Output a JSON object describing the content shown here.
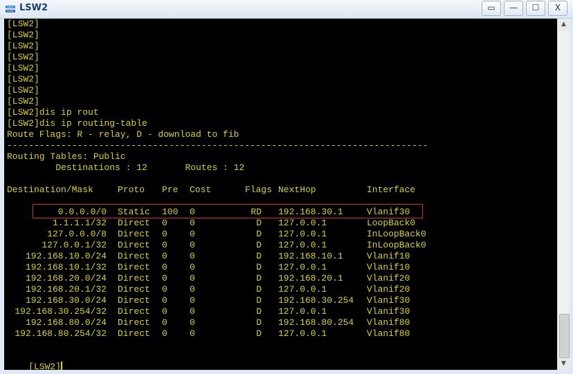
{
  "window": {
    "title": "LSW2",
    "icon": "switch-icon",
    "buttons": [
      {
        "name": "restore-frame-button",
        "glyph": "▭"
      },
      {
        "name": "minimize-button",
        "glyph": "—"
      },
      {
        "name": "maximize-button",
        "glyph": "☐"
      },
      {
        "name": "close-button",
        "glyph": "X"
      }
    ]
  },
  "terminal": {
    "lines": [
      "[LSW2]",
      "[LSW2]",
      "[LSW2]",
      "[LSW2]",
      "[LSW2]",
      "[LSW2]",
      "[LSW2]",
      "[LSW2]",
      "[LSW2]dis ip rout",
      "[LSW2]dis ip routing-table",
      "Route Flags: R - relay, D - download to fib",
      "------------------------------------------------------------------------------",
      "Routing Tables: Public",
      "         Destinations : 12       Routes : 12"
    ],
    "table": {
      "headers": {
        "destination": "Destination/Mask",
        "proto": "Proto",
        "pre": "Pre",
        "cost": "Cost",
        "flags": "Flags",
        "nexthop": "NextHop",
        "interface": "Interface"
      },
      "rows": [
        {
          "destination": "0.0.0.0/0",
          "proto": "Static",
          "pre": "100",
          "cost": "0",
          "flags": "RD",
          "nexthop": "192.168.30.1",
          "interface": "Vlanif30"
        },
        {
          "destination": "1.1.1.1/32",
          "proto": "Direct",
          "pre": "0",
          "cost": "0",
          "flags": "D",
          "nexthop": "127.0.0.1",
          "interface": "LoopBack0"
        },
        {
          "destination": "127.0.0.0/8",
          "proto": "Direct",
          "pre": "0",
          "cost": "0",
          "flags": "D",
          "nexthop": "127.0.0.1",
          "interface": "InLoopBack0"
        },
        {
          "destination": "127.0.0.1/32",
          "proto": "Direct",
          "pre": "0",
          "cost": "0",
          "flags": "D",
          "nexthop": "127.0.0.1",
          "interface": "InLoopBack0"
        },
        {
          "destination": "192.168.10.0/24",
          "proto": "Direct",
          "pre": "0",
          "cost": "0",
          "flags": "D",
          "nexthop": "192.168.10.1",
          "interface": "Vlanif10"
        },
        {
          "destination": "192.168.10.1/32",
          "proto": "Direct",
          "pre": "0",
          "cost": "0",
          "flags": "D",
          "nexthop": "127.0.0.1",
          "interface": "Vlanif10"
        },
        {
          "destination": "192.168.20.0/24",
          "proto": "Direct",
          "pre": "0",
          "cost": "0",
          "flags": "D",
          "nexthop": "192.168.20.1",
          "interface": "Vlanif20"
        },
        {
          "destination": "192.168.20.1/32",
          "proto": "Direct",
          "pre": "0",
          "cost": "0",
          "flags": "D",
          "nexthop": "127.0.0.1",
          "interface": "Vlanif20"
        },
        {
          "destination": "192.168.30.0/24",
          "proto": "Direct",
          "pre": "0",
          "cost": "0",
          "flags": "D",
          "nexthop": "192.168.30.254",
          "interface": "Vlanif30"
        },
        {
          "destination": "192.168.30.254/32",
          "proto": "Direct",
          "pre": "0",
          "cost": "0",
          "flags": "D",
          "nexthop": "127.0.0.1",
          "interface": "Vlanif30"
        },
        {
          "destination": "192.168.80.0/24",
          "proto": "Direct",
          "pre": "0",
          "cost": "0",
          "flags": "D",
          "nexthop": "192.168.80.254",
          "interface": "Vlanif80"
        },
        {
          "destination": "192.168.80.254/32",
          "proto": "Direct",
          "pre": "0",
          "cost": "0",
          "flags": "D",
          "nexthop": "127.0.0.1",
          "interface": "Vlanif80"
        }
      ]
    },
    "prompt": "[LSW2]",
    "text_color": "#d9d21f",
    "background": "#000000",
    "highlight_color": "#d23030"
  },
  "scrollbar": {
    "up_glyph": "▲",
    "down_glyph": "▼"
  }
}
